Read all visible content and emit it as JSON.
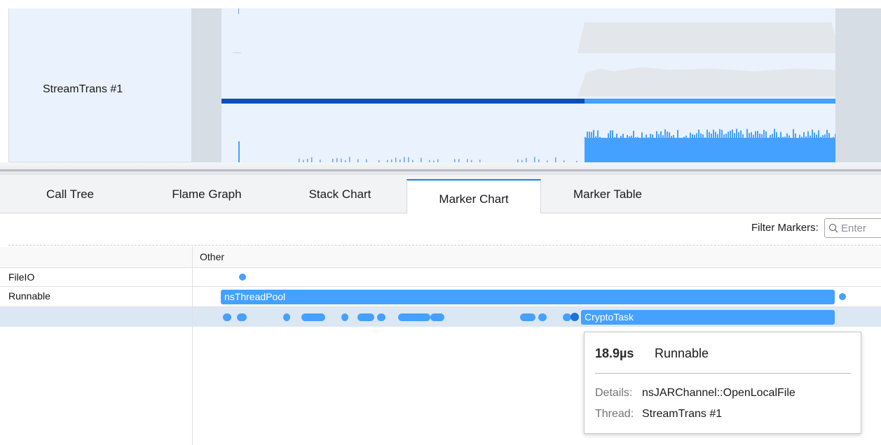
{
  "track": {
    "label": "StreamTrans #1"
  },
  "tabs": [
    {
      "label": "Call Tree",
      "selected": false
    },
    {
      "label": "Flame Graph",
      "selected": false
    },
    {
      "label": "Stack Chart",
      "selected": false
    },
    {
      "label": "Marker Chart",
      "selected": true
    },
    {
      "label": "Marker Table",
      "selected": false
    }
  ],
  "filter": {
    "label": "Filter Markers:",
    "placeholder": "Enter",
    "icon": "search-icon"
  },
  "marker_chart": {
    "category_header": "Other",
    "rows": [
      {
        "label": "FileIO"
      },
      {
        "label": "Runnable"
      },
      {
        "label": ""
      }
    ],
    "markers": {
      "runnable_main": "nsThreadPool",
      "crypto": "CryptoTask"
    }
  },
  "tooltip": {
    "duration": "18.9µs",
    "name": "Runnable",
    "details_key": "Details:",
    "details_value": "nsJARChannel::OpenLocalFile",
    "thread_key": "Thread:",
    "thread_value": "StreamTrans #1"
  },
  "colors": {
    "accent": "#0a84ff",
    "marker": "#45a1ff",
    "marker_dark": "#1a73d9",
    "track_dark": "#0b4fb5",
    "track_light": "#45a1ff",
    "graph_bg": "#e9f2fd",
    "selected_row": "#dbe7f3"
  }
}
